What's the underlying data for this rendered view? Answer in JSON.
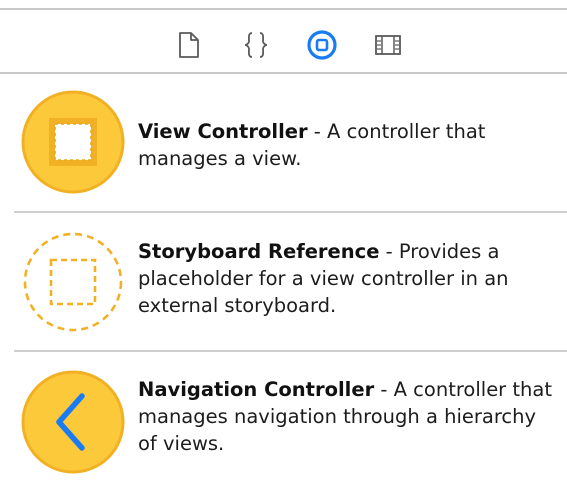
{
  "toolbar": {
    "icons": [
      {
        "name": "file-template-icon",
        "selected": false
      },
      {
        "name": "code-snippet-icon",
        "selected": false
      },
      {
        "name": "object-library-icon",
        "selected": true
      },
      {
        "name": "media-library-icon",
        "selected": false
      }
    ]
  },
  "colors": {
    "accent": "#1a7cf5",
    "icon_fill": "#fcc93a",
    "icon_stroke": "#f2b125",
    "divider": "#cfcfcf",
    "text": "#1c1c1c"
  },
  "library": {
    "items": [
      {
        "icon": "view-controller-icon",
        "title": "View Controller",
        "separator": " - ",
        "description": "A controller that manages a view."
      },
      {
        "icon": "storyboard-reference-icon",
        "title": "Storyboard Reference",
        "separator": " - ",
        "description": "Provides a placeholder for a view controller in an external storyboard."
      },
      {
        "icon": "navigation-controller-icon",
        "title": "Navigation Controller",
        "separator": " - ",
        "description": "A controller that manages navigation through a hierarchy of views."
      }
    ]
  }
}
